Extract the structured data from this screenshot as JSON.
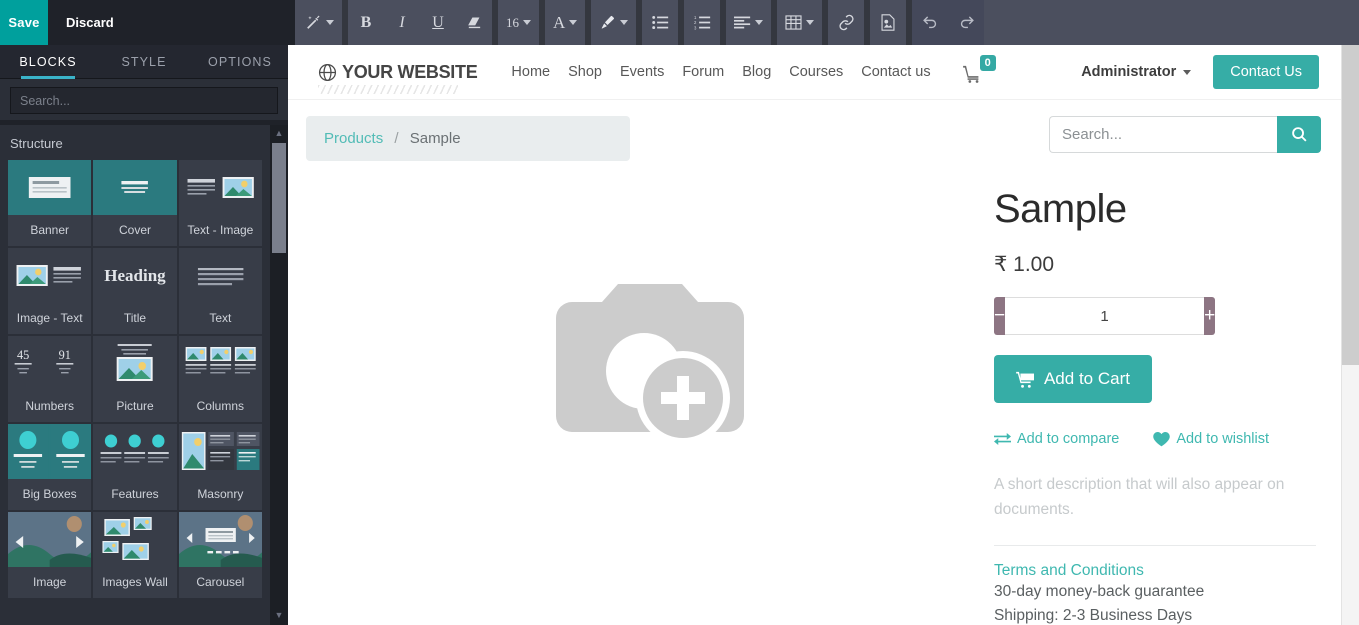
{
  "editor": {
    "save_label": "Save",
    "discard_label": "Discard",
    "toolbar": {
      "font_size": "16",
      "buttons": [
        {
          "name": "magic-wand-icon",
          "label": "Style"
        },
        {
          "name": "bold-icon",
          "label": "B"
        },
        {
          "name": "italic-icon",
          "label": "I"
        },
        {
          "name": "underline-icon",
          "label": "U"
        },
        {
          "name": "eraser-icon",
          "label": "Remove Format"
        },
        {
          "name": "font-size-selector",
          "label": "16"
        },
        {
          "name": "font-color-icon",
          "label": "A"
        },
        {
          "name": "background-color-icon",
          "label": "Paint"
        },
        {
          "name": "unordered-list-icon",
          "label": "Bullet List"
        },
        {
          "name": "ordered-list-icon",
          "label": "Numbered List"
        },
        {
          "name": "align-icon",
          "label": "Align"
        },
        {
          "name": "table-icon",
          "label": "Table"
        },
        {
          "name": "link-icon",
          "label": "Link"
        },
        {
          "name": "image-icon",
          "label": "Image"
        },
        {
          "name": "undo-icon",
          "label": "Undo"
        },
        {
          "name": "redo-icon",
          "label": "Redo"
        }
      ]
    },
    "tabs": [
      {
        "id": "blocks",
        "label": "BLOCKS",
        "active": true
      },
      {
        "id": "style",
        "label": "STYLE",
        "active": false
      },
      {
        "id": "options",
        "label": "OPTIONS",
        "active": false
      }
    ],
    "search_placeholder": "Search...",
    "section_title": "Structure",
    "blocks": [
      {
        "label": "Banner",
        "thumb": "teal"
      },
      {
        "label": "Cover",
        "thumb": "teal"
      },
      {
        "label": "Text - Image",
        "thumb": "dark"
      },
      {
        "label": "Image - Text",
        "thumb": "dark"
      },
      {
        "label": "Title",
        "thumb": "dark"
      },
      {
        "label": "Text",
        "thumb": "dark"
      },
      {
        "label": "Numbers",
        "thumb": "dark"
      },
      {
        "label": "Picture",
        "thumb": "dark"
      },
      {
        "label": "Columns",
        "thumb": "dark"
      },
      {
        "label": "Big Boxes",
        "thumb": "teal"
      },
      {
        "label": "Features",
        "thumb": "dark"
      },
      {
        "label": "Masonry",
        "thumb": "dark"
      },
      {
        "label": "Image",
        "thumb": "blue"
      },
      {
        "label": "Images Wall",
        "thumb": "dark"
      },
      {
        "label": "Carousel",
        "thumb": "blue"
      }
    ]
  },
  "site": {
    "brand": "YOUR WEBSITE",
    "nav": [
      "Home",
      "Shop",
      "Events",
      "Forum",
      "Blog",
      "Courses",
      "Contact us"
    ],
    "cart_count": "0",
    "user": "Administrator",
    "contact_button": "Contact Us",
    "breadcrumb": {
      "parent": "Products",
      "separator": "/",
      "current": "Sample"
    },
    "search": {
      "placeholder": "Search...",
      "value": ""
    }
  },
  "product": {
    "title": "Sample",
    "price": "₹ 1.00",
    "quantity": "1",
    "decrease_label": "−",
    "increase_label": "+",
    "add_to_cart": "Add to Cart",
    "compare_label": "Add to compare",
    "wishlist_label": "Add to wishlist",
    "description": "A short description that will also appear on documents.",
    "terms_link": "Terms and Conditions",
    "guarantee": "30-day money-back guarantee",
    "shipping": "Shipping: 2-3 Business Days"
  },
  "colors": {
    "accent_teal": "#36ada6",
    "save_green": "#00a09d",
    "editor_dark": "#1f2229",
    "toolbar_grey": "#4b4f5e",
    "qty_button": "#8d7583",
    "tab_underline": "#3ab3c9"
  }
}
